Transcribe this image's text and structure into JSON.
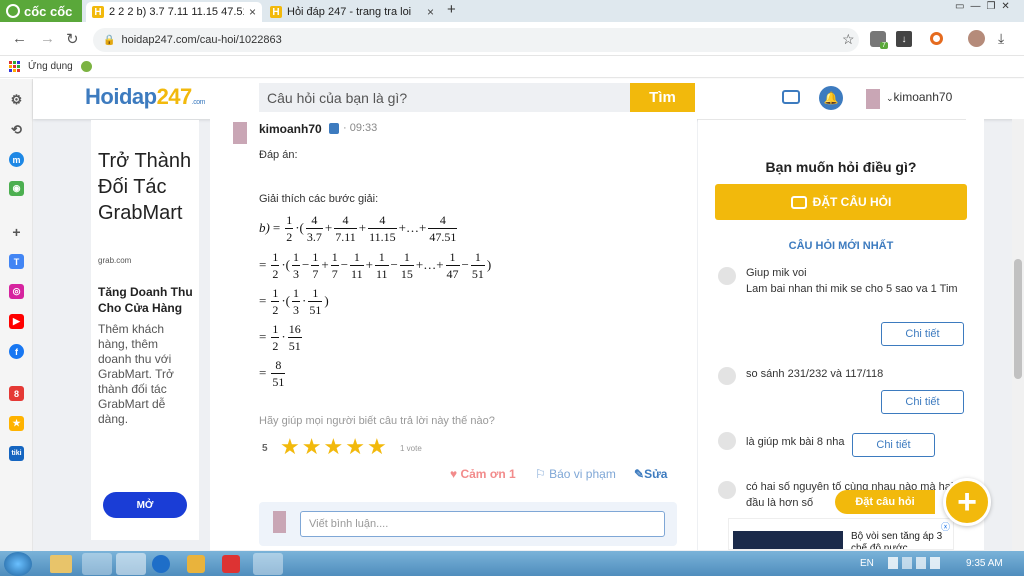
{
  "browser": {
    "brand": "cốc cốc",
    "tabs": [
      {
        "title": "2 2 2 b) 3.7 7.11 11.15 47.51 -",
        "close": "×"
      },
      {
        "title": "Hỏi đáp 247 - trang tra loi",
        "close": "×"
      }
    ],
    "new_tab": "+",
    "window_controls": [
      "▭",
      "—",
      "❐",
      "✕"
    ],
    "url": "hoidap247.com/cau-hoi/1022863",
    "bookmarks_label": "Ứng dụng",
    "badge_count": "7"
  },
  "site": {
    "logo_main": "Hoidap",
    "logo_num": "247",
    "logo_com": ".com",
    "search_placeholder": "Câu hỏi của bạn là gì?",
    "search_button": "Tìm",
    "username": "kimoanh70"
  },
  "ad": {
    "headline": "Trở Thành Đối Tác GrabMart",
    "domain": "grab.com",
    "subheadline": "Tăng Doanh Thu Cho Cửa Hàng",
    "body": "Thêm khách hàng, thêm doanh thu với GrabMart. Trở thành đối tác GrabMart dễ dàng.",
    "cta": "MỞ"
  },
  "answer": {
    "author": "kimoanh70",
    "time": "09:33",
    "label_answer": "Đáp án:",
    "label_explain": "Giải thích các bước giải:",
    "feedback_prompt": "Hãy giúp mọi người biết câu trả lời này thế nào?",
    "rating": "5",
    "votes": "1 vote",
    "thanks": "Cảm ơn 1",
    "report": "Báo vi phạm",
    "edit": "Sửa",
    "comment_placeholder": "Viết bình luận...."
  },
  "math": {
    "b": "b)",
    "eq": "=",
    "half_n": "1",
    "half_d": "2",
    "f4_37": {
      "n": "4",
      "d": "3.7"
    },
    "f4_711": {
      "n": "4",
      "d": "7.11"
    },
    "f4_1115": {
      "n": "4",
      "d": "11.15"
    },
    "f4_4751": {
      "n": "4",
      "d": "47.51"
    },
    "dots": "+…+",
    "one": "1",
    "d3": "3",
    "d7": "7",
    "d11": "11",
    "d15": "15",
    "d47": "47",
    "d51": "51",
    "n16": "16",
    "n8": "8"
  },
  "sidebar": {
    "ask_title": "Bạn muốn hỏi điều gì?",
    "ask_button": "ĐẶT CÂU HỎI",
    "newest_title": "CÂU HỎI MỚI NHẤT",
    "questions": [
      {
        "text": "Giup mik voi\nLam bai nhan thi mik se cho 5 sao va 1 Tim",
        "button": "Chi tiết"
      },
      {
        "text": "so sánh 231/232 và 117/118",
        "button": "Chi tiết"
      },
      {
        "text": "là giúp mk bài 8 nha",
        "button": "Chi tiết"
      },
      {
        "text": "có hai số nguyên tố cùng nhau nào mà hai đầu là hơn số",
        "button": "Chi tiết"
      }
    ],
    "float_label": "Đặt câu hỏi",
    "float_plus": "+",
    "ad_text": "Bộ vòi sen tăng áp 3 chế độ nước"
  },
  "taskbar": {
    "lang": "EN",
    "time": "9:35 AM"
  },
  "colors": {
    "accent_yellow": "#f2b90c",
    "brand_blue": "#3d7bbf",
    "star": "#f2b90c"
  }
}
